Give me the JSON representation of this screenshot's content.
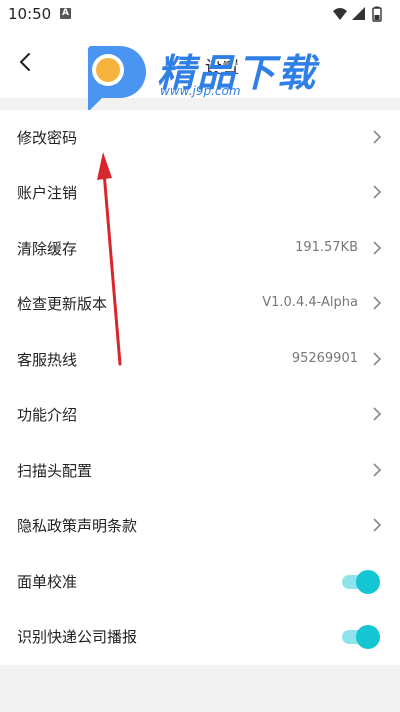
{
  "status_bar": {
    "time": "10:50",
    "notification_badge": "A"
  },
  "header": {
    "title": "设置"
  },
  "watermark": {
    "brand": "精品下载",
    "url": "www.j9p.com"
  },
  "settings": {
    "items": [
      {
        "label": "修改密码",
        "value": "",
        "type": "link"
      },
      {
        "label": "账户注销",
        "value": "",
        "type": "link"
      },
      {
        "label": "清除缓存",
        "value": "191.57KB",
        "type": "link"
      },
      {
        "label": "检查更新版本",
        "value": "V1.0.4.4-Alpha",
        "type": "link"
      },
      {
        "label": "客服热线",
        "value": "95269901",
        "type": "link"
      },
      {
        "label": "功能介绍",
        "value": "",
        "type": "link"
      },
      {
        "label": "扫描头配置",
        "value": "",
        "type": "link"
      },
      {
        "label": "隐私政策声明条款",
        "value": "",
        "type": "link"
      },
      {
        "label": "面单校准",
        "value": "",
        "type": "toggle",
        "on": true
      },
      {
        "label": "识别快递公司播报",
        "value": "",
        "type": "toggle",
        "on": true
      }
    ]
  },
  "colors": {
    "toggle_on": "#14c6d3",
    "toggle_track": "#8fe3ea",
    "annotation_arrow": "#d8262b",
    "watermark": "#2e7fe6"
  }
}
